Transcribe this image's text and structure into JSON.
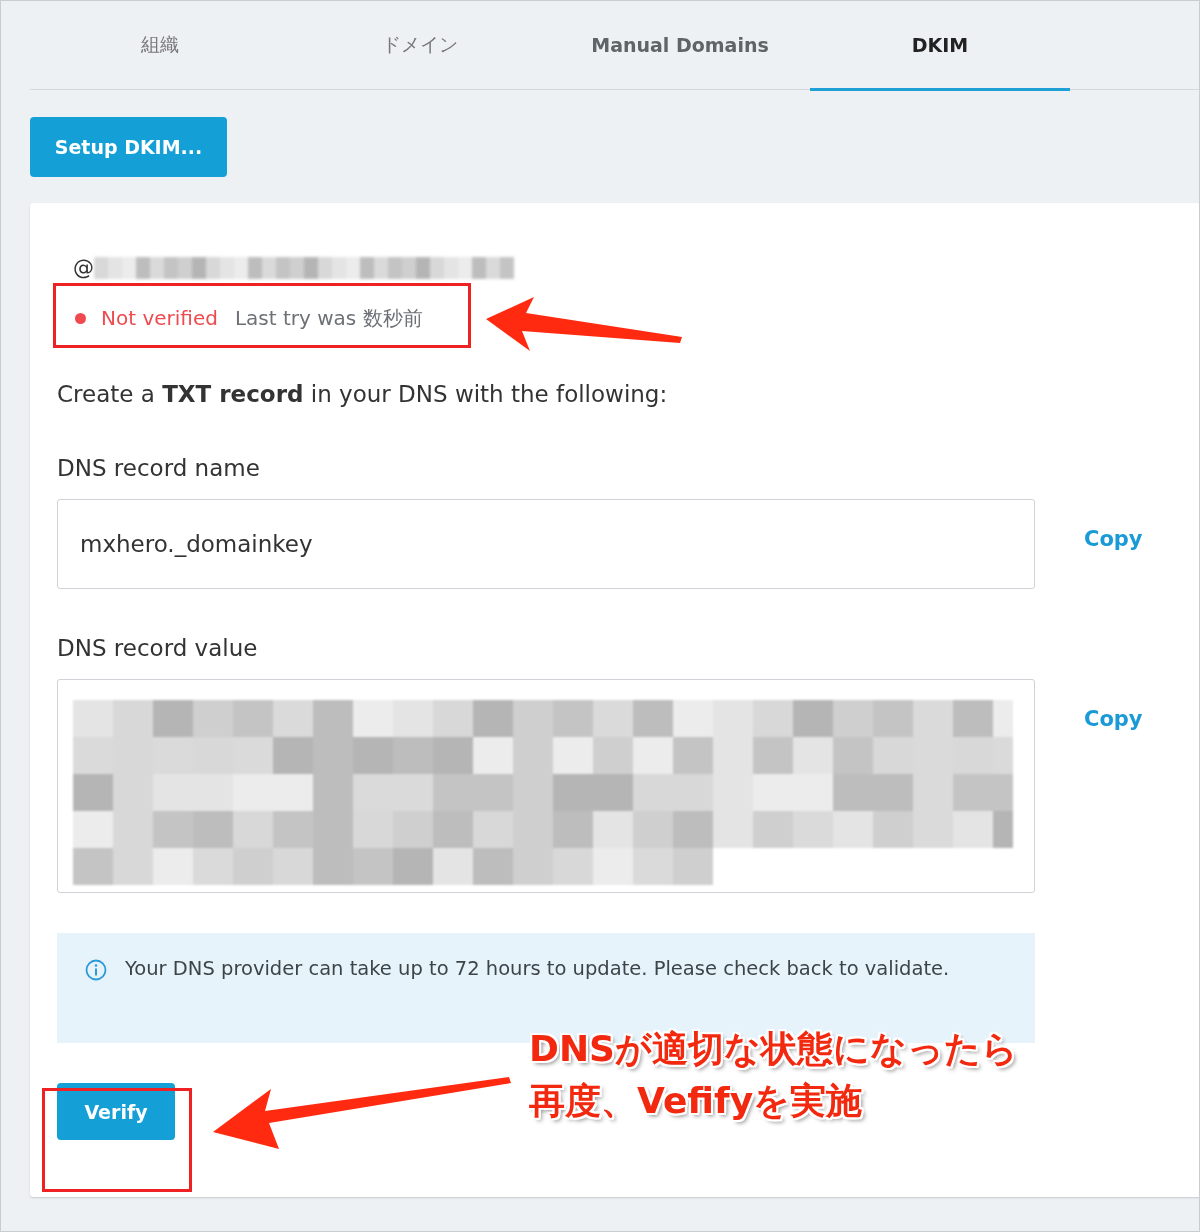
{
  "tabs": [
    {
      "label": "組織",
      "selected": false
    },
    {
      "label": "ドメイン",
      "selected": false
    },
    {
      "label": "Manual Domains",
      "selected": false
    },
    {
      "label": "DKIM",
      "selected": true
    }
  ],
  "setup_button": "Setup DKIM...",
  "domain": {
    "prefix": "@"
  },
  "status": {
    "verified": false,
    "label": "Not verified",
    "detail": "Last try was 数秒前"
  },
  "instruction": "Create a **TXT record** in your DNS with the following:",
  "fields": [
    {
      "label": "DNS record name",
      "value": "mxhero._domainkey",
      "copy": "Copy"
    },
    {
      "label": "DNS record value",
      "copy": "Copy"
    }
  ],
  "info": "Your DNS provider can take up to 72 hours to update. Please check back to validate.",
  "verify_button": "Verify",
  "annotation": [
    "DNSが適切な状態になったら",
    "再度、Vefifyを実施"
  ]
}
